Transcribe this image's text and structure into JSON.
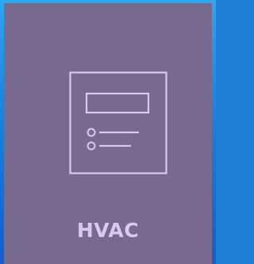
{
  "tile": {
    "label": "HVAC",
    "icon": "thermostat-panel-icon",
    "colors": {
      "tile_background": "#786a8e",
      "icon_stroke": "#d9c9f2",
      "label_text": "#d9c9f2",
      "page_background": "#1e88e0"
    }
  }
}
